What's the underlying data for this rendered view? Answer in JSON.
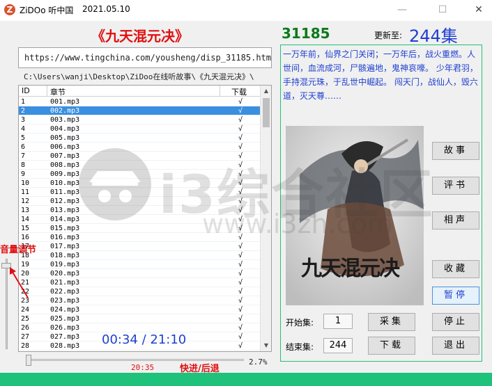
{
  "window": {
    "app_title": "ZiDOo 听中国",
    "date": "2021.05.10",
    "minimize_icon": "minimize-icon",
    "maximize_icon": "maximize-icon",
    "close_icon": "close-icon"
  },
  "book": {
    "title": "《九天混元决》",
    "id": "31185",
    "updated_label": "更新至:",
    "episode_count": "244集",
    "url": "https://www.tingchina.com/yousheng/disp_31185.htm",
    "path": "C:\\Users\\wanji\\Desktop\\ZiDoo在线听故事\\《九天混元决》\\",
    "description": "一万年前，仙界之门关闭；一万年后，战火重燃。人世间，血流成河，尸骸遍地，鬼神哀嚎。 少年君羽，手持混元珠，于乱世中崛起。 闯天门，战仙人，毁六道，灭天尊……",
    "cover_caption": "九天混元决"
  },
  "list": {
    "headers": {
      "id": "ID",
      "chapter": "章节",
      "download": "下载"
    },
    "selected_index": 1,
    "rows": [
      {
        "id": "1",
        "chapter": "001.mp3",
        "dl": "√"
      },
      {
        "id": "2",
        "chapter": "002.mp3",
        "dl": "√"
      },
      {
        "id": "3",
        "chapter": "003.mp3",
        "dl": "√"
      },
      {
        "id": "4",
        "chapter": "004.mp3",
        "dl": "√"
      },
      {
        "id": "5",
        "chapter": "005.mp3",
        "dl": "√"
      },
      {
        "id": "6",
        "chapter": "006.mp3",
        "dl": "√"
      },
      {
        "id": "7",
        "chapter": "007.mp3",
        "dl": "√"
      },
      {
        "id": "8",
        "chapter": "008.mp3",
        "dl": "√"
      },
      {
        "id": "9",
        "chapter": "009.mp3",
        "dl": "√"
      },
      {
        "id": "10",
        "chapter": "010.mp3",
        "dl": "√"
      },
      {
        "id": "11",
        "chapter": "011.mp3",
        "dl": "√"
      },
      {
        "id": "12",
        "chapter": "012.mp3",
        "dl": "√"
      },
      {
        "id": "13",
        "chapter": "013.mp3",
        "dl": "√"
      },
      {
        "id": "14",
        "chapter": "014.mp3",
        "dl": "√"
      },
      {
        "id": "15",
        "chapter": "015.mp3",
        "dl": "√"
      },
      {
        "id": "16",
        "chapter": "016.mp3",
        "dl": "√"
      },
      {
        "id": "17",
        "chapter": "017.mp3",
        "dl": "√"
      },
      {
        "id": "18",
        "chapter": "018.mp3",
        "dl": "√"
      },
      {
        "id": "19",
        "chapter": "019.mp3",
        "dl": "√"
      },
      {
        "id": "20",
        "chapter": "020.mp3",
        "dl": "√"
      },
      {
        "id": "21",
        "chapter": "021.mp3",
        "dl": "√"
      },
      {
        "id": "22",
        "chapter": "022.mp3",
        "dl": "√"
      },
      {
        "id": "23",
        "chapter": "023.mp3",
        "dl": "√"
      },
      {
        "id": "24",
        "chapter": "024.mp3",
        "dl": "√"
      },
      {
        "id": "25",
        "chapter": "025.mp3",
        "dl": "√"
      },
      {
        "id": "26",
        "chapter": "026.mp3",
        "dl": "√"
      },
      {
        "id": "27",
        "chapter": "027.mp3",
        "dl": "√"
      },
      {
        "id": "28",
        "chapter": "028.mp3",
        "dl": "√"
      }
    ]
  },
  "player": {
    "volume_label": "音量调节",
    "elapsed_overlay": "00:34 / 21:10",
    "seek_time": "20:35",
    "seek_label": "快进/后退",
    "percent": "2.7%"
  },
  "categories": {
    "story": "故事",
    "pingshu": "评书",
    "xiangsheng": "相声",
    "favorite": "收藏",
    "pause": "暂停"
  },
  "controls": {
    "start_label": "开始集:",
    "start_value": "1",
    "end_label": "结束集:",
    "end_value": "244",
    "collect": "采集",
    "stop": "停止",
    "download": "下载",
    "exit": "退出"
  },
  "watermark": {
    "text": "i3综合社区",
    "url": "www.i3zh.com"
  },
  "colors": {
    "accent_red": "#e01010",
    "accent_blue": "#1f3fd0",
    "accent_green": "#1ec27a",
    "id_green": "#0a7a1a",
    "selection": "#3a8fe0"
  }
}
